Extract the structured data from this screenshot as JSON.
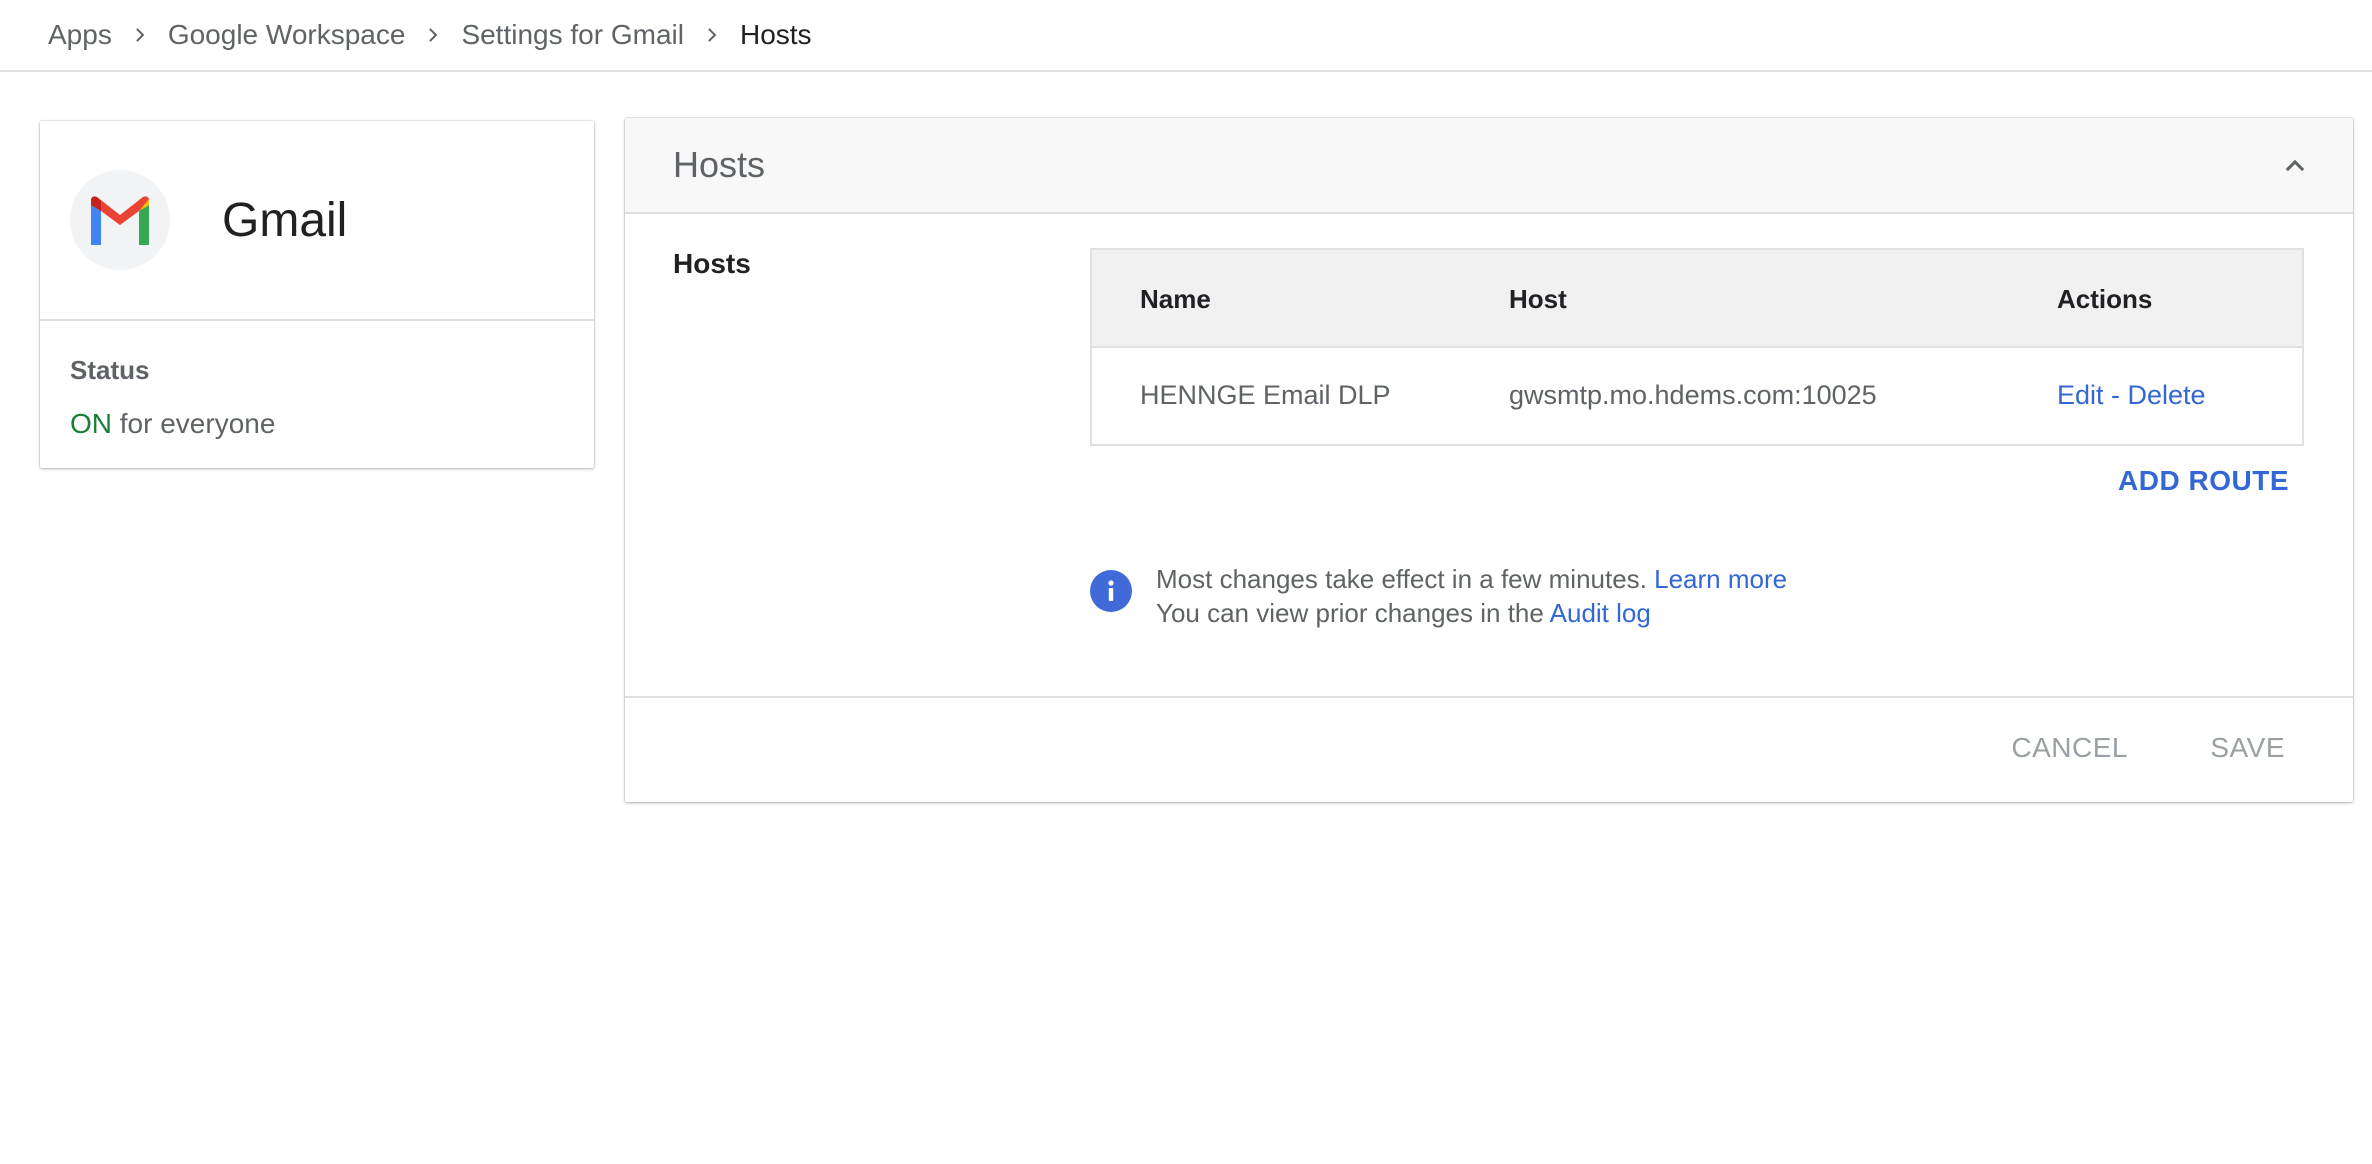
{
  "breadcrumb": {
    "items": [
      "Apps",
      "Google Workspace",
      "Settings for Gmail"
    ],
    "current": "Hosts"
  },
  "app": {
    "name": "Gmail",
    "logo_icon": "gmail-logo",
    "status_label": "Status",
    "status_on": "ON",
    "status_suffix": " for everyone"
  },
  "panel": {
    "title": "Hosts",
    "section_label": "Hosts",
    "table": {
      "headers": [
        "Name",
        "Host",
        "Actions"
      ],
      "rows": [
        {
          "name": "HENNGE Email DLP",
          "host": "gwsmtp.mo.hdems.com:10025",
          "edit": "Edit",
          "separator": " - ",
          "delete": "Delete"
        }
      ]
    },
    "add_route_label": "ADD ROUTE",
    "info": {
      "line1": "Most changes take effect in a few minutes. ",
      "learn_more": "Learn more",
      "line2": "You can view prior changes in the ",
      "audit_log": "Audit log"
    },
    "cancel_label": "CANCEL",
    "save_label": "SAVE"
  },
  "colors": {
    "link": "#3367d6",
    "status_on": "#188038",
    "info_icon": "#3f6ad8"
  }
}
